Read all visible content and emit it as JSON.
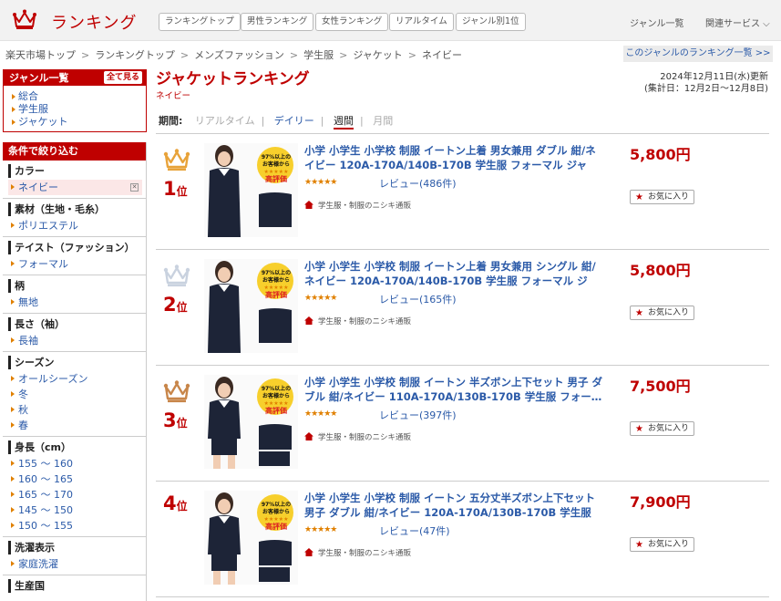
{
  "header": {
    "logo_icon": "crown-icon",
    "title": "ランキング",
    "nav": [
      "ランキングトップ",
      "男性ランキング",
      "女性ランキング",
      "リアルタイム",
      "ジャンル別1位"
    ],
    "genre_list": "ジャンル一覧",
    "related": "関連サービス ⌵"
  },
  "breadcrumb": [
    "楽天市場トップ",
    "ランキングトップ",
    "メンズファッション",
    "学生服",
    "ジャケット",
    "ネイビー"
  ],
  "breadcrumb_sep": ">",
  "genre_ranking_link": "このジャンルのランキング一覧 >>",
  "sidebar": {
    "genre_title": "ジャンル一覧",
    "see_all": "全て見る",
    "genres": [
      "総合",
      "学生服",
      "ジャケット"
    ],
    "filter_title": "条件で絞り込む",
    "groups": [
      {
        "head": "カラー",
        "items": [
          "ネイビー"
        ],
        "selected": 0
      },
      {
        "head": "素材（生地・毛糸）",
        "items": [
          "ポリエステル"
        ]
      },
      {
        "head": "テイスト（ファッション）",
        "items": [
          "フォーマル"
        ]
      },
      {
        "head": "柄",
        "items": [
          "無地"
        ]
      },
      {
        "head": "長さ（袖）",
        "items": [
          "長袖"
        ]
      },
      {
        "head": "シーズン",
        "items": [
          "オールシーズン",
          "冬",
          "秋",
          "春"
        ]
      },
      {
        "head": "身長（cm）",
        "items": [
          "155 〜 160",
          "160 〜 165",
          "165 〜 170",
          "145 〜 150",
          "150 〜 155"
        ]
      },
      {
        "head": "洗濯表示",
        "items": [
          "家庭洗濯"
        ]
      },
      {
        "head": "生産国",
        "items": []
      }
    ]
  },
  "page": {
    "title": "ジャケットランキング",
    "subtitle": "ネイビー",
    "updated": "2024年12月11日(水)更新",
    "period_range": "(集計日：12月2日〜12月8日)",
    "period_label": "期間:",
    "periods": [
      "リアルタイム",
      "デイリー",
      "週間",
      "月間"
    ]
  },
  "items": [
    {
      "rank": "1",
      "rank_suffix": "位",
      "crown": "gold",
      "title": "小学 小学生 小学校 制服 イートン上着 男女兼用 ダブル 紺/ネイビー 120A-170A/140B-170B 学生服 フォーマル ジャケ…",
      "stars": "★★★★★",
      "rating": 4.5,
      "review": "レビュー(486件)",
      "shop": "学生服・制服のニシキ通販",
      "price": "5,800円",
      "fav": "お気に入り",
      "badge_pct": "97%以上の",
      "badge_line2": "お客様から",
      "badge_line3": "高評価"
    },
    {
      "rank": "2",
      "rank_suffix": "位",
      "crown": "silver",
      "title": "小学 小学生 小学校 制服 イートン上着 男女兼用 シングル 紺/ネイビー 120A-170A/140B-170B 学生服 フォーマル ジャ…",
      "stars": "★★★★★",
      "rating": 4.5,
      "review": "レビュー(165件)",
      "shop": "学生服・制服のニシキ通販",
      "price": "5,800円",
      "fav": "お気に入り",
      "badge_pct": "97%以上の",
      "badge_line2": "お客様から",
      "badge_line3": "高評価"
    },
    {
      "rank": "3",
      "rank_suffix": "位",
      "crown": "bronze",
      "title": "小学 小学生 小学校 制服 イートン 半ズボン上下セット 男子 ダブル 紺/ネイビー 110A-170A/130B-170B 学生服 フォー…",
      "stars": "★★★★★",
      "rating": 4.5,
      "review": "レビュー(397件)",
      "shop": "学生服・制服のニシキ通販",
      "price": "7,500円",
      "fav": "お気に入り",
      "badge_pct": "97%以上の",
      "badge_line2": "お客様から",
      "badge_line3": "高評価"
    },
    {
      "rank": "4",
      "rank_suffix": "位",
      "crown": "none",
      "title": "小学 小学生 小学校 制服 イートン 五分丈半ズボン上下セット 男子 ダブル 紺/ネイビー 120A-170A/130B-170B 学生服 …",
      "stars": "★★★★★",
      "rating": 4.5,
      "review": "レビュー(47件)",
      "shop": "学生服・制服のニシキ通販",
      "price": "7,900円",
      "fav": "お気に入り",
      "badge_pct": "97%以上の",
      "badge_line2": "お客様から",
      "badge_line3": "高評価"
    }
  ],
  "colors": {
    "brand": "#bf0000",
    "link": "#2b5aa8",
    "gold": "#e8a33a",
    "silver": "#c9d2df",
    "bronze": "#c8864a",
    "star": "#e08000"
  }
}
